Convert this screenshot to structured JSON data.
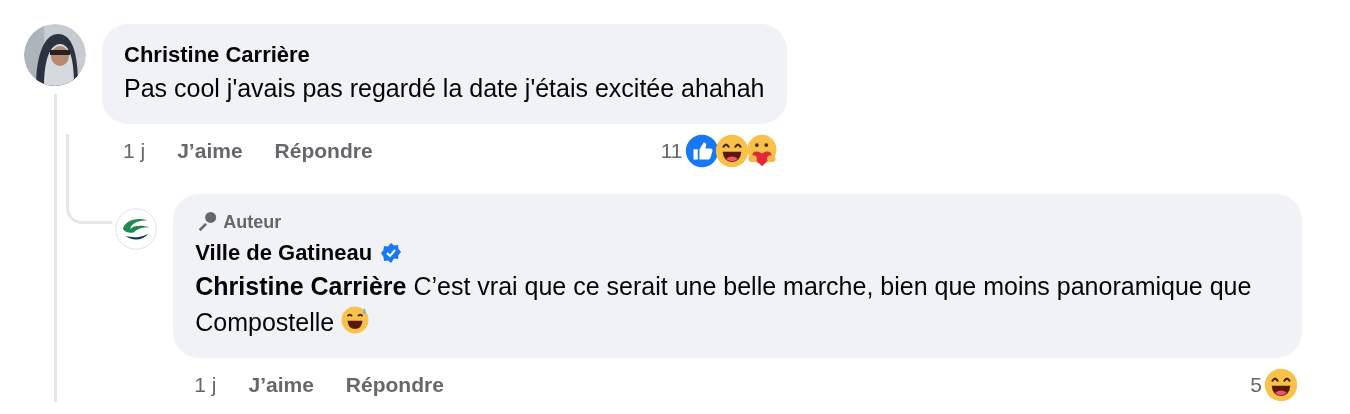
{
  "comments": [
    {
      "avatar": {
        "kind": "picture"
      },
      "author": "Christine Carrière",
      "text": "Pas cool j'avais pas regardé la date j'étais excitée ahahah",
      "time": "1 j",
      "actions": [
        "J’aime",
        "Répondre"
      ],
      "reaction_count": "11",
      "reactions": [
        {
          "kind": "like"
        },
        {
          "kind": "haha"
        },
        {
          "kind": "care"
        }
      ],
      "replies": [
        {
          "avatar": {
            "kind": "logo"
          },
          "badge": "Auteur",
          "author": "Ville de Gatineau",
          "verified": true,
          "text": "**Christine Carrière** C’est vrai que ce serait une belle marche, bien que moins panoramique que Compostelle",
          "emoji": {
            "kind": "sweat-smile"
          },
          "time": "1 j",
          "actions": [
            "J’aime",
            "Répondre"
          ],
          "reaction_count": "5",
          "reactions": [
            {
              "kind": "haha"
            }
          ]
        }
      ]
    }
  ]
}
